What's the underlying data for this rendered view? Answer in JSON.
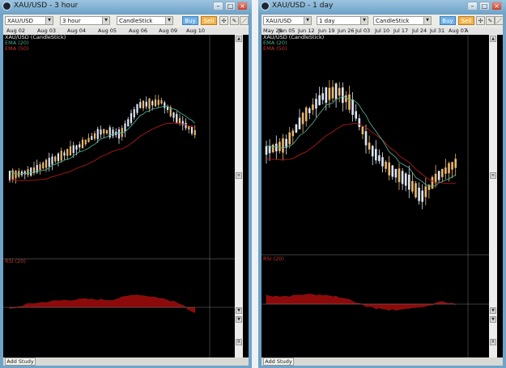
{
  "left_window": {
    "title": "XAU/USD - 3 hour",
    "symbol": "XAU/USD",
    "timeframe": "3 hour",
    "chart_type": "CandleStick",
    "buy_label": "Buy",
    "sell_label": "Sell",
    "dates": [
      "Aug 02",
      "Aug 03",
      "Aug 04",
      "Aug 05",
      "Aug 06",
      "Aug 09",
      "Aug 10"
    ],
    "legend_main": "XAU/USD (CandleStick)",
    "legend_ema20": "EMA (20)",
    "legend_ema50": "EMA (50)",
    "rsi_label": "RSI (20)",
    "add_study": "Add Study"
  },
  "right_window": {
    "title": "XAU/USD - 1 day",
    "symbol": "XAU/USD",
    "timeframe": "1 day",
    "chart_type": "CandleStick",
    "buy_label": "Buy",
    "sell_label": "Sell",
    "dates": [
      "May 29",
      "Jun 05",
      "Jun 12",
      "Jun 19",
      "Jun 26",
      "Jul 03",
      "Jul 10",
      "Jul 17",
      "Jul 24",
      "Jul 31",
      "Aug 07",
      "A"
    ],
    "legend_main": "XAU/USD (CandleStick)",
    "legend_ema20": "EMA (20)",
    "legend_ema50": "EMA (50)",
    "rsi_label": "RSI (20)",
    "add_study": "Add Study"
  },
  "colors": {
    "window_frame": "#6fa3c8",
    "chart_background": "#000000",
    "candle_up": "#dfe6f4",
    "candle_down": "#e9b870",
    "ema20": "#4fa88e",
    "ema50": "#b01818",
    "rsi_fill": "#8c0a0a",
    "buy": "#6fb1e8",
    "sell": "#f1b54d"
  },
  "icons": [
    "app-icon",
    "minimize-icon",
    "maximize-icon",
    "close-icon",
    "dropdown-arrow-icon",
    "crosshair-icon",
    "pencil-icon",
    "line-tool-icon",
    "scroll-up-icon",
    "scroll-down-icon",
    "zoom-icon"
  ]
}
